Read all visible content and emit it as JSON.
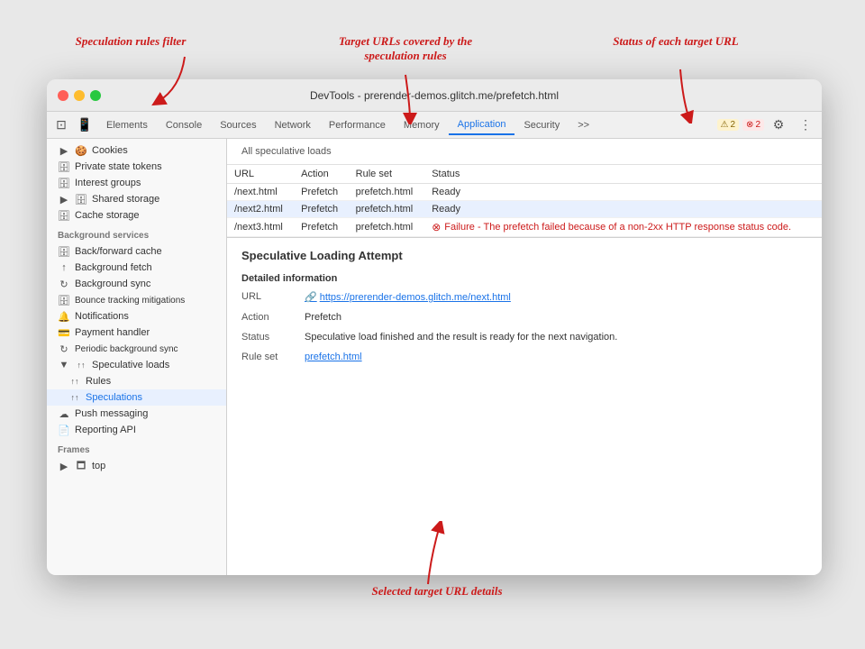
{
  "annotations": {
    "speculation_rules_filter": "Speculation rules filter",
    "target_urls": "Target URLs covered by\nthe speculation rules",
    "status_label": "Status of each target URL",
    "selected_details": "Selected target URL details"
  },
  "window": {
    "title": "DevTools - prerender-demos.glitch.me/prefetch.html"
  },
  "devtools": {
    "tabs": [
      {
        "label": "Elements",
        "active": false
      },
      {
        "label": "Console",
        "active": false
      },
      {
        "label": "Sources",
        "active": false
      },
      {
        "label": "Network",
        "active": false
      },
      {
        "label": "Performance",
        "active": false
      },
      {
        "label": "Memory",
        "active": false
      },
      {
        "label": "Application",
        "active": true
      },
      {
        "label": "Security",
        "active": false
      },
      {
        "label": ">>",
        "active": false
      }
    ],
    "badges": {
      "warning": "2",
      "error": "2"
    }
  },
  "sidebar": {
    "sections": [
      {
        "items": [
          {
            "label": "Cookies",
            "icon": "▶",
            "hasArrow": true,
            "indent": 0
          },
          {
            "label": "Private state tokens",
            "icon": "🗄",
            "hasArrow": false,
            "indent": 0
          },
          {
            "label": "Interest groups",
            "icon": "🗄",
            "hasArrow": false,
            "indent": 0
          },
          {
            "label": "Shared storage",
            "icon": "▶",
            "hasArrow": true,
            "indent": 0
          },
          {
            "label": "Cache storage",
            "icon": "🗄",
            "hasArrow": false,
            "indent": 0
          }
        ]
      },
      {
        "label": "Background services",
        "items": [
          {
            "label": "Back/forward cache",
            "icon": "🗄",
            "indent": 0
          },
          {
            "label": "Background fetch",
            "icon": "↑",
            "indent": 0
          },
          {
            "label": "Background sync",
            "icon": "↻",
            "indent": 0
          },
          {
            "label": "Bounce tracking mitigations",
            "icon": "🗄",
            "indent": 0
          },
          {
            "label": "Notifications",
            "icon": "🔔",
            "indent": 0
          },
          {
            "label": "Payment handler",
            "icon": "💳",
            "indent": 0
          },
          {
            "label": "Periodic background sync",
            "icon": "↻",
            "indent": 0
          },
          {
            "label": "Speculative loads",
            "icon": "↑↑",
            "indent": 0,
            "expanded": true
          },
          {
            "label": "Rules",
            "icon": "↑↑",
            "indent": 1
          },
          {
            "label": "Speculations",
            "icon": "↑↑",
            "indent": 1,
            "selected": true
          },
          {
            "label": "Push messaging",
            "icon": "☁",
            "indent": 0
          },
          {
            "label": "Reporting API",
            "icon": "📄",
            "indent": 0
          }
        ]
      },
      {
        "label": "Frames",
        "items": [
          {
            "label": "top",
            "icon": "▶",
            "hasArrow": true,
            "indent": 0
          }
        ]
      }
    ]
  },
  "main": {
    "all_speculative_loads": "All speculative loads",
    "table": {
      "headers": [
        "URL",
        "Action",
        "Rule set",
        "Status"
      ],
      "rows": [
        {
          "url": "/next.html",
          "action": "Prefetch",
          "ruleset": "prefetch.html",
          "status": "Ready",
          "error": false,
          "selected": false
        },
        {
          "url": "/next2.html",
          "action": "Prefetch",
          "ruleset": "prefetch.html",
          "status": "Ready",
          "error": false,
          "selected": true
        },
        {
          "url": "/next3.html",
          "action": "Prefetch",
          "ruleset": "prefetch.html",
          "status": "⊗ Failure - The prefetch failed because of a non-2xx HTTP response status code.",
          "error": true,
          "selected": false
        }
      ]
    },
    "detail": {
      "title": "Speculative Loading Attempt",
      "section_label": "Detailed information",
      "rows": [
        {
          "key": "URL",
          "value": "https://prerender-demos.glitch.me/next.html",
          "isLink": true
        },
        {
          "key": "Action",
          "value": "Prefetch",
          "isLink": false
        },
        {
          "key": "Status",
          "value": "Speculative load finished and the result is ready for the next navigation.",
          "isLink": false
        },
        {
          "key": "Rule set",
          "value": "prefetch.html",
          "isLink": true
        }
      ]
    }
  }
}
